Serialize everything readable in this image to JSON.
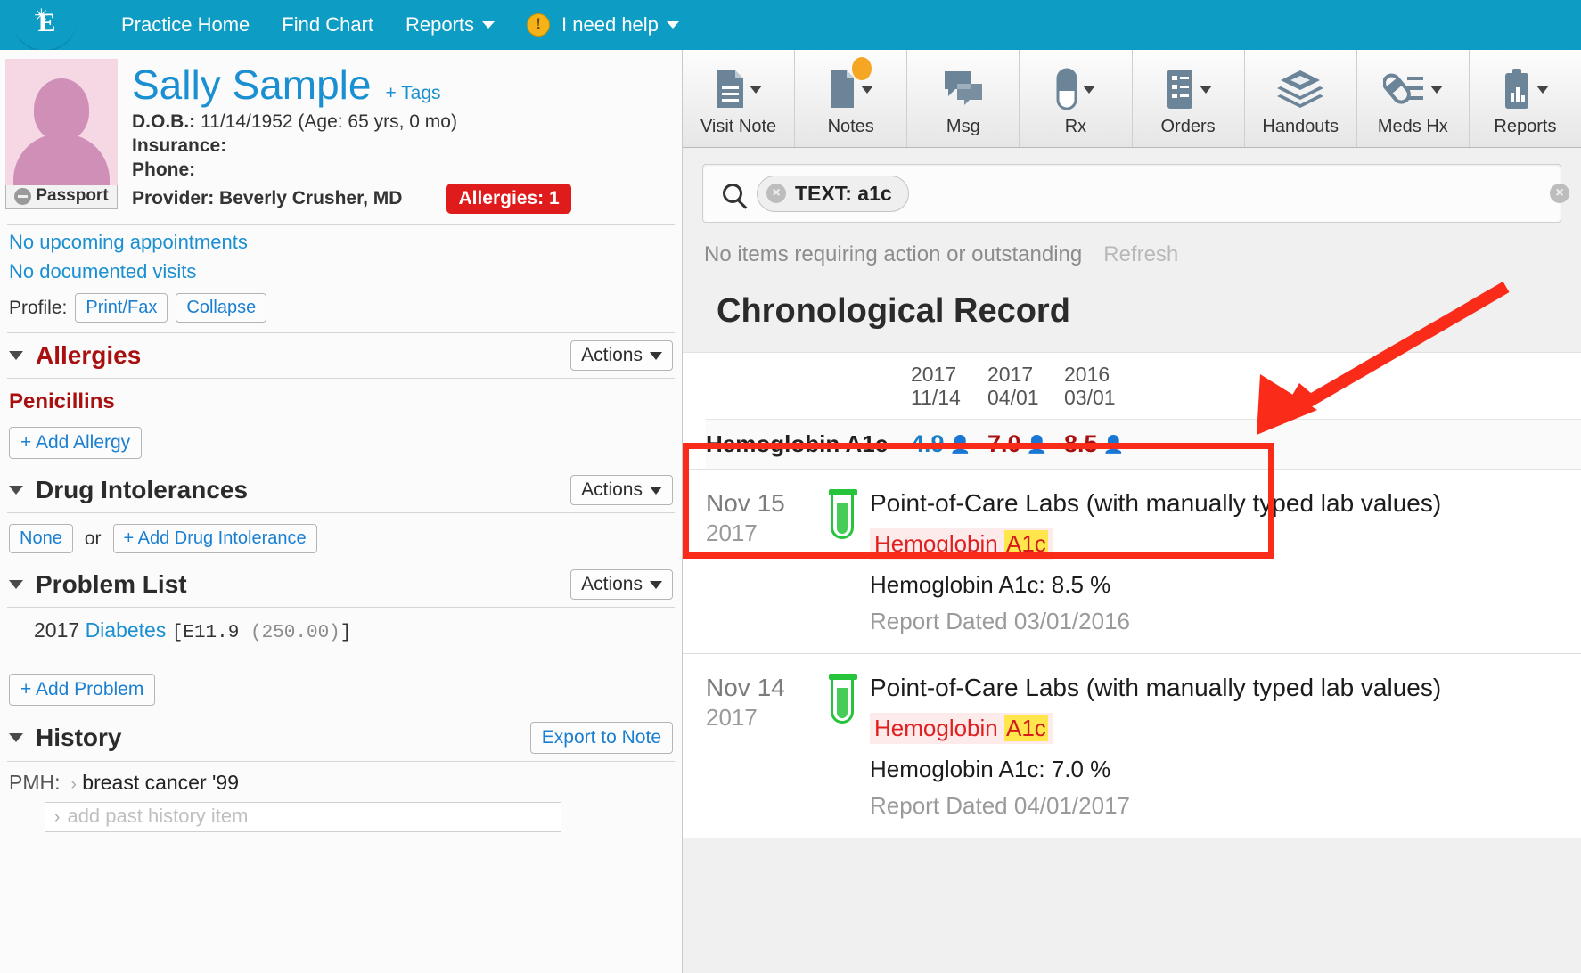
{
  "topnav": {
    "logo_letter": "E",
    "items": [
      {
        "label": "Practice Home",
        "has_caret": false
      },
      {
        "label": "Find Chart",
        "has_caret": false
      },
      {
        "label": "Reports",
        "has_caret": true
      },
      {
        "label": "I need help",
        "has_caret": true,
        "icon": "warning-icon"
      }
    ]
  },
  "patient": {
    "name": "Sally Sample",
    "tags_link": "+ Tags",
    "passport_label": "Passport",
    "dob_label": "D.O.B.:",
    "dob_value": "11/14/1952 (Age: 65 yrs, 0 mo)",
    "insurance_label": "Insurance:",
    "insurance_value": "",
    "phone_label": "Phone:",
    "phone_value": "",
    "provider_line": "Provider: Beverly Crusher, MD",
    "allergies_badge": "Allergies: 1",
    "appointments_link": "No upcoming appointments",
    "visits_link": "No documented visits",
    "profile_label": "Profile:",
    "print_fax_btn": "Print/Fax",
    "collapse_btn": "Collapse"
  },
  "sidebar": {
    "allergies": {
      "title": "Allergies",
      "actions_label": "Actions",
      "items": [
        "Penicillins"
      ],
      "add_label": "+ Add Allergy"
    },
    "drug_intolerances": {
      "title": "Drug Intolerances",
      "actions_label": "Actions",
      "none_label": "None",
      "or_label": "or",
      "add_label": "+ Add Drug Intolerance"
    },
    "problem_list": {
      "title": "Problem List",
      "actions_label": "Actions",
      "rows": [
        {
          "year": "2017",
          "name": "Diabetes",
          "code_open": "[",
          "icd10": "E11.9",
          "icd9": "(250.00)",
          "code_close": "]"
        }
      ],
      "add_label": "+ Add Problem"
    },
    "history": {
      "title": "History",
      "export_label": "Export to Note",
      "pmh_label": "PMH:",
      "pmh_items": [
        "breast cancer '99"
      ],
      "pmh_add_placeholder": "add past history item"
    }
  },
  "toolbar": {
    "buttons": [
      {
        "label": "Visit Note",
        "icon": "document-lines-icon",
        "caret": true,
        "badge": false
      },
      {
        "label": "Notes",
        "icon": "note-page-icon",
        "caret": true,
        "badge": true
      },
      {
        "label": "Msg",
        "icon": "speech-bubble-icon",
        "caret": false,
        "badge": false
      },
      {
        "label": "Rx",
        "icon": "pill-capsule-icon",
        "caret": true,
        "badge": false
      },
      {
        "label": "Orders",
        "icon": "list-clipboard-icon",
        "caret": true,
        "badge": false
      },
      {
        "label": "Handouts",
        "icon": "stacked-layers-icon",
        "caret": false,
        "badge": false
      },
      {
        "label": "Meds Hx",
        "icon": "pills-list-icon",
        "caret": true,
        "badge": false
      },
      {
        "label": "Reports",
        "icon": "chart-clipboard-icon",
        "caret": true,
        "badge": true
      }
    ]
  },
  "search": {
    "icon": "search-icon",
    "chip_label": "TEXT: a1c",
    "chip_remove_icon": "remove-chip-icon",
    "clear_all_icon": "clear-all-icon"
  },
  "status": {
    "message": "No items requiring action or outstanding",
    "refresh_label": "Refresh"
  },
  "main": {
    "section_title": "Chronological Record"
  },
  "lab_table": {
    "row_label": "Hemoglobin A1c",
    "columns": [
      {
        "year": "2017",
        "monthday": "11/14",
        "value": "4.9",
        "tone": "blue",
        "source_icon": "person-icon"
      },
      {
        "year": "2017",
        "monthday": "04/01",
        "value": "7.0",
        "tone": "red",
        "source_icon": "person-icon"
      },
      {
        "year": "2016",
        "monthday": "03/01",
        "value": "8.5",
        "tone": "red",
        "source_icon": "person-icon"
      }
    ]
  },
  "entries": [
    {
      "date_day": "Nov 15",
      "date_year": "2017",
      "icon": "test-tube-icon",
      "title": "Point-of-Care Labs (with manually typed lab values)",
      "highlight_prefix": "Hemoglobin ",
      "highlight_match": "A1c",
      "value_line": "Hemoglobin A1c: 8.5 %",
      "report_line": "Report Dated 03/01/2016"
    },
    {
      "date_day": "Nov 14",
      "date_year": "2017",
      "icon": "test-tube-icon",
      "title": "Point-of-Care Labs (with manually typed lab values)",
      "highlight_prefix": "Hemoglobin ",
      "highlight_match": "A1c",
      "value_line": "Hemoglobin A1c: 7.0 %",
      "report_line": "Report Dated 04/01/2017"
    }
  ],
  "annotations": {
    "arrow_color": "#fa2b18",
    "box_color": "#fa2b18"
  },
  "colors": {
    "brand_teal": "#0c9cc4",
    "link_blue": "#1a8fd1",
    "alert_red": "#e01b1b",
    "allergy_maroon": "#a81010"
  }
}
